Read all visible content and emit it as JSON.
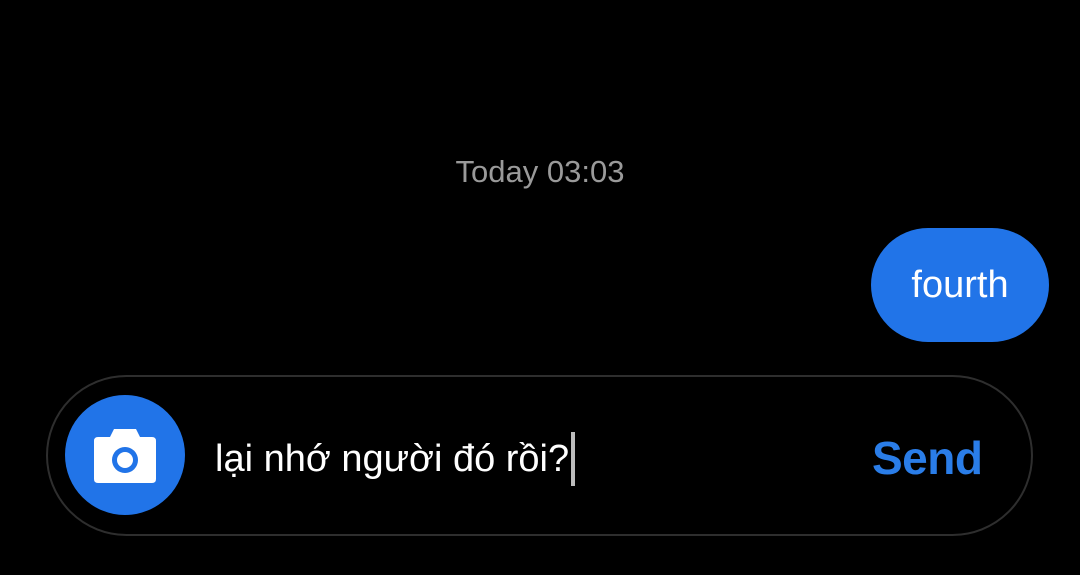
{
  "conversation": {
    "timestamp": "Today 03:03",
    "messages": [
      {
        "direction": "sent",
        "text": "fourth"
      }
    ]
  },
  "composer": {
    "camera_icon": "camera-icon",
    "input_value": "lại nhớ người đó rồi?",
    "send_label": "Send"
  },
  "colors": {
    "background": "#000000",
    "accent": "#2174e8",
    "send_text": "#2a7de8",
    "timestamp_text": "#9a9a9a",
    "composer_border": "#2e2e2e"
  }
}
